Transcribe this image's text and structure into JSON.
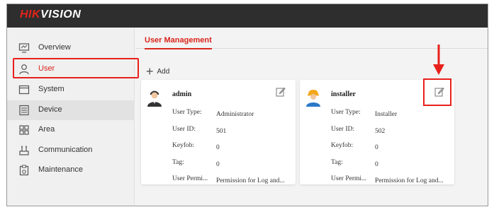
{
  "header": {
    "logo_red": "HIK",
    "logo_rest": "VISION"
  },
  "sidebar": {
    "items": [
      {
        "label": "Overview",
        "icon": "monitor-icon"
      },
      {
        "label": "User",
        "icon": "user-icon"
      },
      {
        "label": "System",
        "icon": "window-icon"
      },
      {
        "label": "Device",
        "icon": "device-icon"
      },
      {
        "label": "Area",
        "icon": "grid-icon"
      },
      {
        "label": "Communication",
        "icon": "network-icon"
      },
      {
        "label": "Maintenance",
        "icon": "clipboard-icon"
      }
    ]
  },
  "main": {
    "tab": "User Management",
    "add_label": "Add"
  },
  "users": [
    {
      "name": "admin",
      "rows": [
        {
          "key": "User Type:",
          "value": "Administrator"
        },
        {
          "key": "User ID:",
          "value": "501"
        },
        {
          "key": "Keyfob:",
          "value": "0"
        },
        {
          "key": "Tag:",
          "value": "0"
        },
        {
          "key": "User Permi...",
          "value": "Permission for Log and..."
        }
      ]
    },
    {
      "name": "installer",
      "rows": [
        {
          "key": "User Type:",
          "value": "Installer"
        },
        {
          "key": "User ID:",
          "value": "502"
        },
        {
          "key": "Keyfob:",
          "value": "0"
        },
        {
          "key": "Tag:",
          "value": "0"
        },
        {
          "key": "User Permi...",
          "value": "Permission for Log and..."
        }
      ]
    }
  ],
  "colors": {
    "accent": "#d9251c",
    "highlight": "#e8201b",
    "topbar": "#2e2e2e"
  }
}
